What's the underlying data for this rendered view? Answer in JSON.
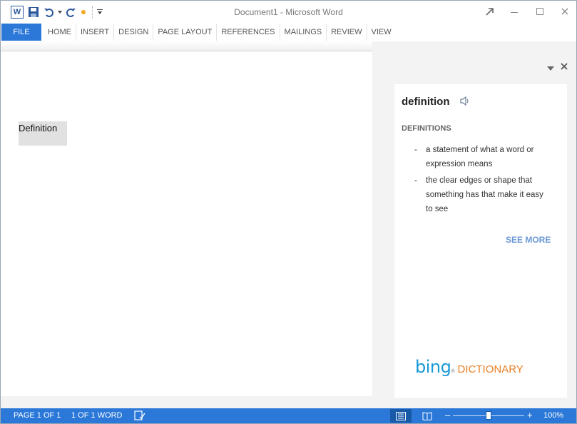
{
  "app": {
    "title": "Document1 - Microsoft Word",
    "logo_letter": "W"
  },
  "quick_access": {
    "icons": [
      "word-logo-icon",
      "save-icon",
      "undo-icon",
      "redo-icon",
      "touch-mode-icon",
      "customize-icon"
    ]
  },
  "window_controls": {
    "icons": [
      "restore-ribbon-icon",
      "minimize-icon",
      "maximize-icon",
      "close-icon"
    ]
  },
  "ribbon": {
    "file_label": "FILE",
    "tabs": [
      "HOME",
      "INSERT",
      "DESIGN",
      "PAGE LAYOUT",
      "REFERENCES",
      "MAILINGS",
      "REVIEW",
      "VIEW"
    ]
  },
  "document": {
    "text": "Definition"
  },
  "dictionary": {
    "headword": "definition",
    "section_label": "DEFINITIONS",
    "definitions": [
      "a statement of what a word or expression means",
      "the clear edges or shape that something has that make it easy to see"
    ],
    "dash": "-",
    "see_more": "SEE MORE",
    "brand_bing": "bing",
    "brand_dictionary": "DICTIONARY",
    "brand_color": "#1a9ad6",
    "dictionary_color": "#e77e23"
  },
  "status": {
    "page": "PAGE 1 OF 1",
    "words": "1 OF 1 WORD",
    "zoom": "100%",
    "accent_color": "#2b78d8"
  }
}
